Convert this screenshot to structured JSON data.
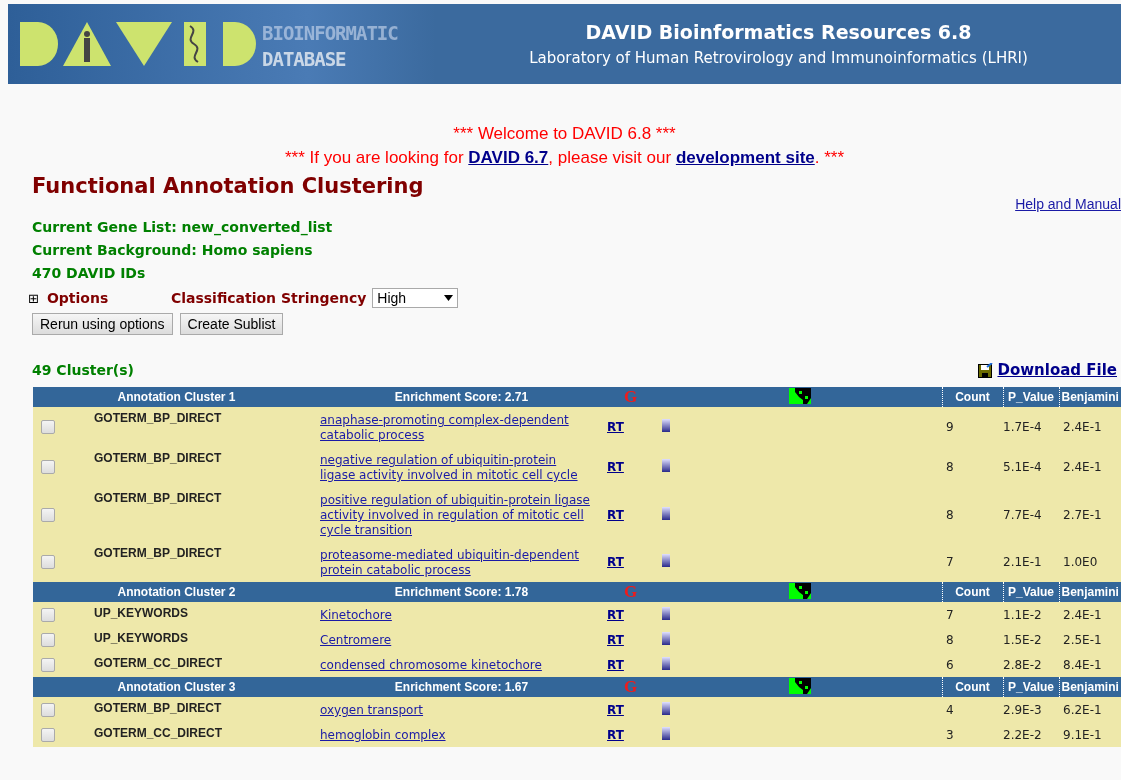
{
  "banner": {
    "logo_words": [
      "BIOINFORMATIC",
      "DATABASE"
    ],
    "title": "DAVID Bioinformatics Resources 6.8",
    "subtitle": "Laboratory of Human Retrovirology and Immunoinformatics (LHRI)"
  },
  "notice": {
    "welcome": "*** Welcome to DAVID 6.8 ***",
    "line_start": "*** If you are looking for",
    "link_1": "DAVID 6.7",
    "line_middle": ", please visit our",
    "link_2": "development site",
    "line_end": ". ***"
  },
  "page_title": "Functional Annotation Clustering",
  "help_link": "Help and Manual",
  "info": [
    "Current Gene List: new_converted_list",
    "Current Background: Homo sapiens",
    "470 DAVID IDs"
  ],
  "options": {
    "expander": "⊞",
    "label": "Options",
    "stringency_label": "Classification Stringency",
    "stringency_value": "High"
  },
  "buttons": [
    "Rerun using options",
    "Create Sublist"
  ],
  "cluster_count": "49 Cluster(s)",
  "download_link": "Download File",
  "clusters": [
    {
      "title": "Annotation Cluster 1",
      "score": "Enrichment Score: 2.71",
      "g": "G",
      "columns": {
        "count": "Count",
        "p_value": "P_Value",
        "benjamini": "Benjamini"
      },
      "rows": [
        {
          "checked": false,
          "category": "GOTERM_BP_DIRECT",
          "term": "anaphase-promoting complex-dependent catabolic process",
          "rt": "RT",
          "count": "9",
          "p_value": "1.7E-4",
          "benjamini": "2.4E-1"
        },
        {
          "checked": false,
          "category": "GOTERM_BP_DIRECT",
          "term": "negative regulation of ubiquitin-protein ligase activity involved in mitotic cell cycle",
          "rt": "RT",
          "count": "8",
          "p_value": "5.1E-4",
          "benjamini": "2.4E-1"
        },
        {
          "checked": false,
          "category": "GOTERM_BP_DIRECT",
          "term": "positive regulation of ubiquitin-protein ligase activity involved in regulation of mitotic cell cycle transition",
          "rt": "RT",
          "count": "8",
          "p_value": "7.7E-4",
          "benjamini": "2.7E-1"
        },
        {
          "checked": false,
          "category": "GOTERM_BP_DIRECT",
          "term": "proteasome-mediated ubiquitin-dependent protein catabolic process",
          "rt": "RT",
          "count": "7",
          "p_value": "2.1E-1",
          "benjamini": "1.0E0"
        }
      ]
    },
    {
      "title": "Annotation Cluster 2",
      "score": "Enrichment Score: 1.78",
      "g": "G",
      "columns": {
        "count": "Count",
        "p_value": "P_Value",
        "benjamini": "Benjamini"
      },
      "rows": [
        {
          "checked": false,
          "category": "UP_KEYWORDS",
          "term": "Kinetochore",
          "rt": "RT",
          "count": "7",
          "p_value": "1.1E-2",
          "benjamini": "2.4E-1"
        },
        {
          "checked": false,
          "category": "UP_KEYWORDS",
          "term": "Centromere",
          "rt": "RT",
          "count": "8",
          "p_value": "1.5E-2",
          "benjamini": "2.5E-1"
        },
        {
          "checked": false,
          "category": "GOTERM_CC_DIRECT",
          "term": "condensed chromosome kinetochore",
          "rt": "RT",
          "count": "6",
          "p_value": "2.8E-2",
          "benjamini": "8.4E-1"
        }
      ]
    },
    {
      "title": "Annotation Cluster 3",
      "score": "Enrichment Score: 1.67",
      "g": "G",
      "columns": {
        "count": "Count",
        "p_value": "P_Value",
        "benjamini": "Benjamini"
      },
      "rows": [
        {
          "checked": false,
          "category": "GOTERM_BP_DIRECT",
          "term": "oxygen transport",
          "rt": "RT",
          "count": "4",
          "p_value": "2.9E-3",
          "benjamini": "6.2E-1"
        },
        {
          "checked": false,
          "category": "GOTERM_CC_DIRECT",
          "term": "hemoglobin complex",
          "rt": "RT",
          "count": "3",
          "p_value": "2.2E-2",
          "benjamini": "9.1E-1"
        }
      ]
    }
  ]
}
